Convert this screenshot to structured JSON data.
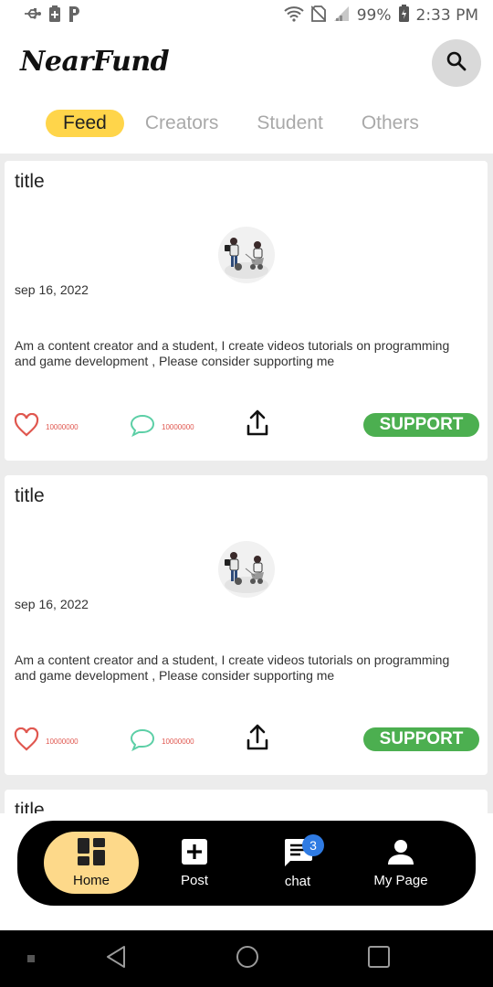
{
  "status_bar": {
    "battery": "99%",
    "time": "2:33 PM"
  },
  "header": {
    "brand": "NearFund"
  },
  "tabs": [
    {
      "label": "Feed"
    },
    {
      "label": "Creators"
    },
    {
      "label": "Student"
    },
    {
      "label": "Others"
    }
  ],
  "posts": [
    {
      "title": "title",
      "date": "sep 16, 2022",
      "description": "Am a content creator and a student, I create videos tutorials on programming and game development , Please consider supporting me",
      "likes": "10000000",
      "comments": "10000000",
      "support_label": "SUPPORT"
    },
    {
      "title": "title",
      "date": "sep 16, 2022",
      "description": "Am a content creator and a student, I create videos tutorials on programming and game development , Please consider supporting me",
      "likes": "10000000",
      "comments": "10000000",
      "support_label": "SUPPORT"
    },
    {
      "title": "title"
    }
  ],
  "bottom_nav": {
    "home": "Home",
    "post": "Post",
    "chat": "chat",
    "chat_badge": "3",
    "my_page": "My Page"
  },
  "colors": {
    "accent_tab": "#ffd54a",
    "support": "#4caf50",
    "home_active": "#fdd98a",
    "badge": "#2f7be3"
  },
  "icons": [
    "usb-icon",
    "battery-saver-icon",
    "parking-icon",
    "wifi-icon",
    "no-sim-icon",
    "signal-icon",
    "battery-icon",
    "search-icon",
    "heart-icon",
    "comment-icon",
    "share-icon",
    "dashboard-icon",
    "add-box-icon",
    "chat-icon",
    "person-icon",
    "back-icon",
    "home-circle-icon",
    "recents-icon"
  ]
}
